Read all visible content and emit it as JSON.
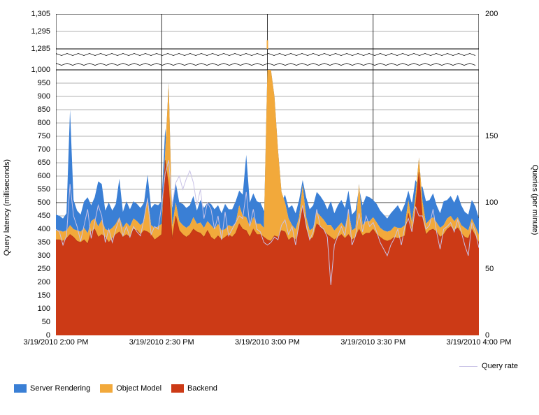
{
  "chart_data": {
    "type": "area",
    "title": "",
    "xlabel": "",
    "ylabel_left": "Query latency (milliseconds)",
    "ylabel_right": "Queries (per minute)",
    "y_left_ticks": [
      0,
      50,
      100,
      150,
      200,
      250,
      300,
      350,
      400,
      450,
      500,
      550,
      600,
      650,
      700,
      750,
      800,
      850,
      900,
      950,
      1000
    ],
    "y_left_upper_ticks": [
      1285,
      1295,
      1305
    ],
    "y_left_range": [
      0,
      1000
    ],
    "y_right_ticks": [
      0,
      50,
      100,
      150,
      200
    ],
    "y_right_range": [
      0,
      200
    ],
    "x_tick_labels": [
      "3/19/2010 2:00 PM",
      "3/19/2010 2:30 PM",
      "3/19/2010 3:00 PM",
      "3/19/2010 3:30 PM",
      "3/19/2010 4:00 PM"
    ],
    "legend_stacked": [
      {
        "name": "Server Rendering",
        "color": "#3a7fd5"
      },
      {
        "name": "Object Model",
        "color": "#f2a93b"
      },
      {
        "name": "Backend",
        "color": "#cc3a16"
      }
    ],
    "legend_line": {
      "name": "Query rate",
      "color": "#c9c2e6"
    },
    "x_minutes": [
      0,
      1,
      2,
      3,
      4,
      5,
      6,
      7,
      8,
      9,
      10,
      11,
      12,
      13,
      14,
      15,
      16,
      17,
      18,
      19,
      20,
      21,
      22,
      23,
      24,
      25,
      26,
      27,
      28,
      29,
      30,
      31,
      32,
      33,
      34,
      35,
      36,
      37,
      38,
      39,
      40,
      41,
      42,
      43,
      44,
      45,
      46,
      47,
      48,
      49,
      50,
      51,
      52,
      53,
      54,
      55,
      56,
      57,
      58,
      59,
      60,
      61,
      62,
      63,
      64,
      65,
      66,
      67,
      68,
      69,
      70,
      71,
      72,
      73,
      74,
      75,
      76,
      77,
      78,
      79,
      80,
      81,
      82,
      83,
      84,
      85,
      86,
      87,
      88,
      89,
      90,
      91,
      92,
      93,
      94,
      95,
      96,
      97,
      98,
      99,
      100,
      101,
      102,
      103,
      104,
      105,
      106,
      107,
      108,
      109,
      110,
      111,
      112,
      113,
      114,
      115,
      116,
      117,
      118,
      119,
      120
    ],
    "series": [
      {
        "name": "Backend",
        "color": "#cc3a16",
        "values": [
          360,
          360,
          355,
          365,
          380,
          370,
          355,
          350,
          360,
          345,
          390,
          400,
          370,
          380,
          370,
          350,
          365,
          380,
          390,
          370,
          380,
          370,
          400,
          395,
          380,
          395,
          390,
          380,
          360,
          370,
          380,
          660,
          560,
          365,
          450,
          395,
          380,
          370,
          380,
          400,
          390,
          385,
          370,
          395,
          370,
          360,
          375,
          360,
          370,
          380,
          370,
          385,
          420,
          400,
          395,
          370,
          400,
          380,
          380,
          370,
          360,
          355,
          375,
          370,
          395,
          390,
          358,
          370,
          360,
          400,
          485,
          400,
          360,
          370,
          420,
          410,
          395,
          380,
          370,
          360,
          370,
          380,
          365,
          380,
          360,
          370,
          400,
          375,
          385,
          385,
          400,
          380,
          370,
          360,
          355,
          360,
          370,
          365,
          370,
          375,
          460,
          390,
          485,
          615,
          440,
          380,
          395,
          400,
          390,
          370,
          380,
          400,
          410,
          395,
          405,
          385,
          370,
          365,
          400,
          375,
          350
        ]
      },
      {
        "name": "Object Model",
        "color": "#f2a93b",
        "values": [
          395,
          395,
          390,
          395,
          415,
          400,
          395,
          390,
          405,
          385,
          430,
          440,
          410,
          435,
          400,
          395,
          405,
          420,
          445,
          405,
          425,
          410,
          440,
          430,
          415,
          430,
          520,
          415,
          405,
          410,
          420,
          690,
          950,
          410,
          500,
          430,
          415,
          405,
          415,
          445,
          420,
          425,
          405,
          430,
          415,
          400,
          420,
          395,
          400,
          415,
          410,
          425,
          490,
          450,
          445,
          410,
          445,
          420,
          420,
          405,
          1290,
          1000,
          900,
          700,
          540,
          500,
          440,
          415,
          400,
          445,
          565,
          445,
          395,
          405,
          465,
          450,
          435,
          415,
          415,
          395,
          410,
          425,
          405,
          470,
          395,
          405,
          570,
          415,
          430,
          430,
          445,
          425,
          405,
          395,
          390,
          395,
          410,
          405,
          405,
          415,
          510,
          425,
          525,
          670,
          505,
          420,
          435,
          445,
          425,
          405,
          415,
          440,
          450,
          430,
          445,
          415,
          405,
          395,
          440,
          410,
          380
        ]
      },
      {
        "name": "Server Rendering",
        "color": "#3a7fd5",
        "values": [
          455,
          450,
          440,
          460,
          850,
          510,
          470,
          455,
          505,
          520,
          490,
          520,
          580,
          570,
          470,
          500,
          470,
          495,
          590,
          465,
          505,
          475,
          505,
          495,
          480,
          500,
          605,
          480,
          495,
          490,
          505,
          780,
          605,
          480,
          575,
          500,
          495,
          480,
          490,
          525,
          470,
          510,
          480,
          500,
          495,
          475,
          490,
          460,
          495,
          475,
          475,
          505,
          545,
          530,
          680,
          500,
          535,
          505,
          500,
          470,
          460,
          465,
          480,
          475,
          500,
          530,
          480,
          490,
          460,
          510,
          585,
          520,
          475,
          490,
          540,
          525,
          505,
          475,
          505,
          460,
          490,
          510,
          480,
          545,
          455,
          470,
          555,
          490,
          525,
          520,
          510,
          495,
          470,
          455,
          440,
          460,
          475,
          490,
          465,
          495,
          545,
          495,
          585,
          560,
          560,
          505,
          510,
          535,
          490,
          460,
          505,
          510,
          525,
          500,
          530,
          490,
          465,
          455,
          510,
          485,
          440
        ]
      }
    ],
    "query_rate": [
      80,
      78,
      68,
      75,
      114,
      90,
      82,
      71,
      83,
      95,
      73,
      85,
      98,
      90,
      70,
      80,
      70,
      80,
      88,
      75,
      82,
      74,
      82,
      78,
      75,
      88,
      103,
      76,
      82,
      80,
      98,
      122,
      132,
      98,
      115,
      120,
      110,
      118,
      124,
      115,
      98,
      110,
      88,
      100,
      95,
      80,
      90,
      72,
      93,
      75,
      80,
      85,
      90,
      88,
      108,
      82,
      95,
      80,
      78,
      70,
      68,
      70,
      74,
      72,
      83,
      87,
      76,
      82,
      68,
      85,
      98,
      83,
      72,
      78,
      95,
      82,
      80,
      74,
      38,
      68,
      75,
      82,
      75,
      95,
      68,
      75,
      92,
      78,
      90,
      82,
      85,
      78,
      70,
      65,
      60,
      68,
      73,
      80,
      68,
      82,
      88,
      78,
      97,
      90,
      90,
      80,
      83,
      95,
      78,
      65,
      80,
      82,
      85,
      78,
      87,
      78,
      68,
      60,
      85,
      78,
      66
    ]
  }
}
